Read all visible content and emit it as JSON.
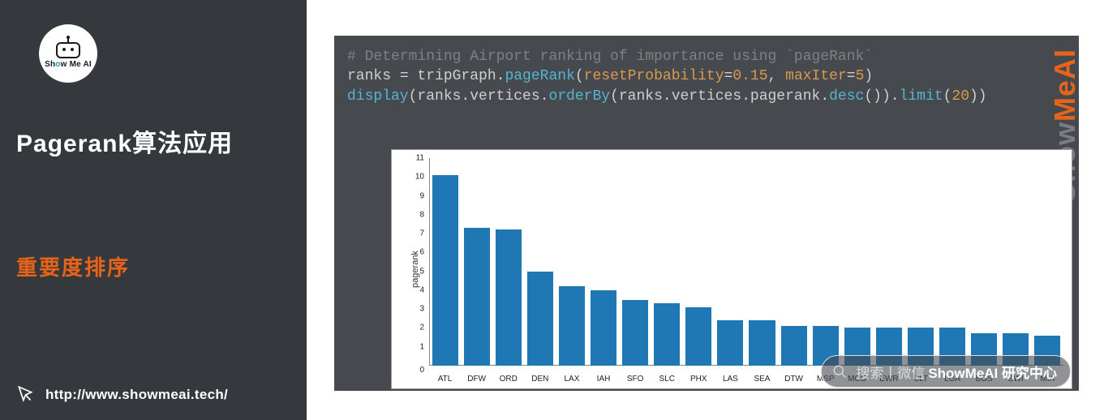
{
  "sidebar": {
    "logo_text_a": "Sh",
    "logo_text_b": "o",
    "logo_text_c": "w Me AI",
    "headline": "Pagerank算法应用",
    "subheadline": "重要度排序",
    "url": "http://www.showmeai.tech/"
  },
  "watermark": {
    "a": "Show",
    "b": "Me",
    "c": "AI"
  },
  "code": {
    "comment": "# Determining Airport ranking of importance using `pageRank`",
    "l2_a": "ranks ",
    "l2_eq": "=",
    "l2_b": " tripGraph.",
    "l2_fn": "pageRank",
    "l2_p1": "(",
    "l2_arg1": "resetProbability",
    "l2_eq2": "=",
    "l2_v1": "0.15",
    "l2_comma": ", ",
    "l2_arg2": "maxIter",
    "l2_eq3": "=",
    "l2_v2": "5",
    "l2_p2": ")",
    "l3_fn": "display",
    "l3_a": "(ranks.vertices.",
    "l3_fn2": "orderBy",
    "l3_b": "(ranks.vertices.pagerank.",
    "l3_fn3": "desc",
    "l3_c": "()).",
    "l3_fn4": "limit",
    "l3_d": "(",
    "l3_v": "20",
    "l3_e": "))"
  },
  "search": {
    "prefix": "搜索丨微信",
    "bold": "ShowMeAI 研究中心"
  },
  "chart_data": {
    "type": "bar",
    "title": "",
    "xlabel": "",
    "ylabel": "pagerank",
    "ylim": [
      0,
      11
    ],
    "yticks": [
      0,
      1,
      2,
      3,
      4,
      5,
      6,
      7,
      8,
      9,
      10,
      11
    ],
    "categories": [
      "ATL",
      "DFW",
      "ORD",
      "DEN",
      "LAX",
      "IAH",
      "SFO",
      "SLC",
      "PHX",
      "LAS",
      "SEA",
      "DTW",
      "MSP",
      "MCO",
      "EWR",
      "CLT",
      "LGA",
      "BOS",
      "BWI",
      "MIA"
    ],
    "values": [
      10.1,
      7.3,
      7.2,
      5.0,
      4.2,
      4.0,
      3.5,
      3.3,
      3.1,
      2.4,
      2.4,
      2.1,
      2.1,
      2.0,
      2.0,
      2.0,
      2.0,
      1.7,
      1.7,
      1.6
    ]
  }
}
